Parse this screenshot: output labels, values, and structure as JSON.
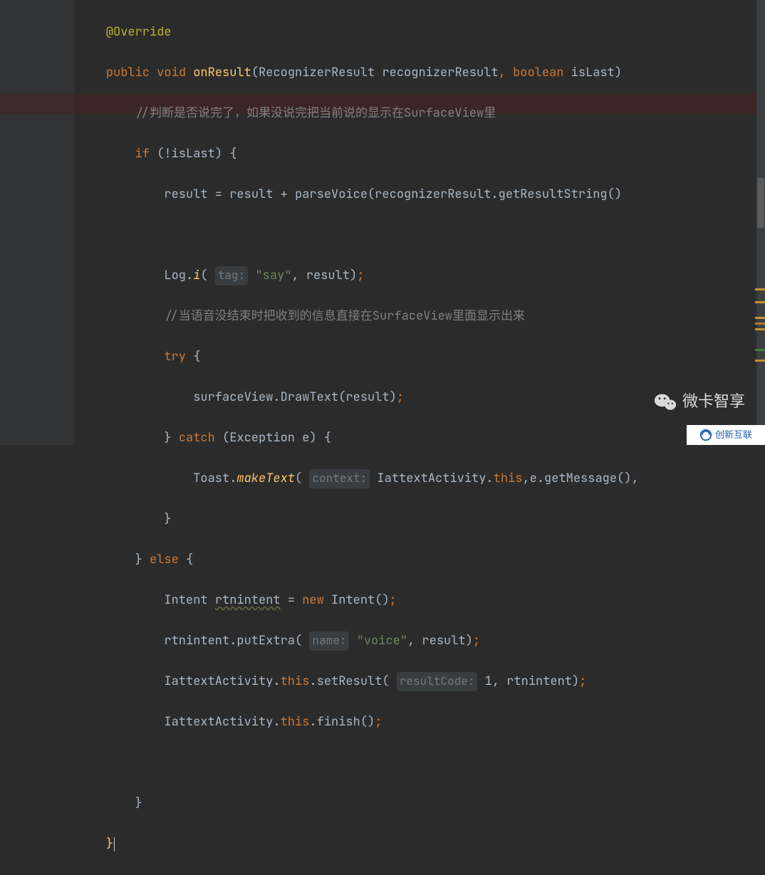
{
  "code": {
    "l1_annot": "@Override",
    "l2_kw1": "public",
    "l2_kw2": "void",
    "l2_fn": "onResult",
    "l2_p1t": "RecognizerResult",
    "l2_p1n": "recognizerResult",
    "l2_p2t": "boolean",
    "l2_p2n": "isLast",
    "l3_cmt": "//判断是否说完了，如果没说完把当前说的显示在SurfaceView里",
    "l4_kw": "if",
    "l4_cond": "(!isLast) {",
    "l5_a": "result",
    "l5_eq": " = ",
    "l5_b": "result",
    "l5_plus": " + ",
    "l5_fn": "parseVoice",
    "l5_c": "(recognizerResult.getResultString()",
    "l7_log": "Log.",
    "l7_i": "i",
    "l7_open": "( ",
    "l7_hint": "tag:",
    "l7_str": "\"say\"",
    "l7_rest": ", result)",
    "l7_semi": ";",
    "l8_cmt": "//当语音没结束时把收到的信息直接在SurfaceView里面显示出来",
    "l9_kw": "try",
    "l9_b": " {",
    "l10_a": "surfaceView.",
    "l10_fn": "DrawText",
    "l10_b": "(result)",
    "l10_semi": ";",
    "l11_a": "} ",
    "l11_kw": "catch",
    "l11_b": " (Exception e) {",
    "l12_a": "Toast.",
    "l12_fn": "makeText",
    "l12_open": "( ",
    "l12_hint": "context:",
    "l12_b": " IattextActivity.",
    "l12_kw": "this",
    "l12_c": ",e.getMessage(),",
    "l13_a": "}",
    "l14_a": "} ",
    "l14_kw": "else",
    "l14_b": " {",
    "l15_a": "Intent ",
    "l15_var": "rtnintent",
    "l15_b": " = ",
    "l15_kw": "new",
    "l15_c": " Intent()",
    "l15_semi": ";",
    "l16_a": "rtnintent.putExtra( ",
    "l16_hint": "name:",
    "l16_sp": " ",
    "l16_str": "\"voice\"",
    "l16_b": ", result)",
    "l16_semi": ";",
    "l17_a": "IattextActivity.",
    "l17_kw": "this",
    "l17_b": ".setResult( ",
    "l17_hint": "resultCode:",
    "l17_c": " 1, rtnintent)",
    "l17_semi": ";",
    "l18_a": "IattextActivity.",
    "l18_kw": "this",
    "l18_b": ".finish()",
    "l18_semi": ";",
    "l20_a": "}",
    "l21_a": "}"
  },
  "watermarks": {
    "wechat_text": "微卡智享",
    "brand_text": "创新互联",
    "brand_sub": ""
  },
  "icons": {
    "wechat": "wechat-icon",
    "brand": "brand-icon"
  }
}
